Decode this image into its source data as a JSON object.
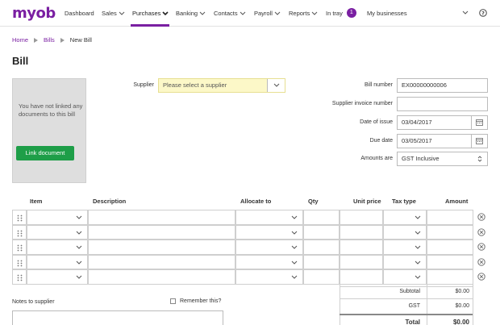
{
  "nav": {
    "logo": "myob",
    "items": [
      {
        "label": "Dashboard",
        "dropdown": false
      },
      {
        "label": "Sales",
        "dropdown": true
      },
      {
        "label": "Purchases",
        "dropdown": true,
        "active": true
      },
      {
        "label": "Banking",
        "dropdown": true
      },
      {
        "label": "Contacts",
        "dropdown": true
      },
      {
        "label": "Payroll",
        "dropdown": true
      },
      {
        "label": "Reports",
        "dropdown": true
      }
    ],
    "in_tray": {
      "label": "In tray",
      "count": "1"
    },
    "businesses": "My businesses",
    "accent_color": "#7a1fa2"
  },
  "breadcrumb": {
    "home": "Home",
    "bills": "Bills",
    "current": "New Bill"
  },
  "page_title": "Bill",
  "documents": {
    "message": "You have not linked any documents to this bill",
    "link_button": "Link document"
  },
  "form": {
    "supplier_label": "Supplier",
    "supplier_placeholder": "Please select a supplier",
    "bill_number_label": "Bill number",
    "bill_number": "EX00000000006",
    "supplier_invoice_label": "Supplier invoice number",
    "supplier_invoice": "",
    "date_issue_label": "Date of issue",
    "date_issue": "03/04/2017",
    "due_date_label": "Due date",
    "due_date": "03/05/2017",
    "amounts_label": "Amounts are",
    "amounts": "GST Inclusive"
  },
  "table": {
    "headers": {
      "item": "Item",
      "description": "Description",
      "allocate": "Allocate to",
      "qty": "Qty",
      "unit_price": "Unit price",
      "tax_type": "Tax type",
      "amount": "Amount"
    },
    "rows": 5
  },
  "totals": {
    "subtotal_label": "Subtotal",
    "subtotal": "$0.00",
    "gst_label": "GST",
    "gst": "$0.00",
    "total_label": "Total",
    "total": "$0.00"
  },
  "notes": {
    "label": "Notes to supplier",
    "remember": "Remember this?"
  }
}
